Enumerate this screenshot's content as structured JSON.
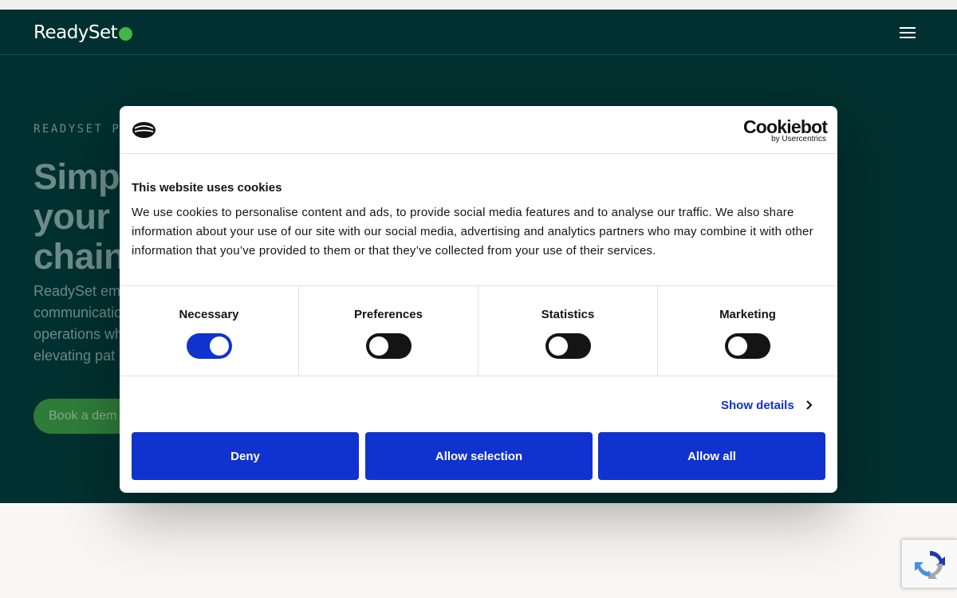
{
  "navbar": {
    "logo_text": "ReadySet",
    "brand_dot_color": "#43b549",
    "menu_icon": "hamburger-menu-icon"
  },
  "hero": {
    "eyebrow": "READYSET PL",
    "headline_lines": [
      "Simp",
      "your s",
      "chain"
    ],
    "lead_lines": [
      "ReadySet em",
      "communicatio",
      "operations wh",
      "elevating pat"
    ],
    "cta_label": "Book a dem"
  },
  "cookie_dialog": {
    "brand_name": "Cookiebot",
    "brand_sub": "by Usercentrics",
    "title": "This website uses cookies",
    "body": "We use cookies to personalise content and ads, to provide social media features and to analyse our traffic. We also share information about your use of our site with our social media, advertising and analytics partners who may combine it with other information that you’ve provided to them or that they’ve collected from your use of their services.",
    "categories": [
      {
        "label": "Necessary",
        "on": true
      },
      {
        "label": "Preferences",
        "on": false
      },
      {
        "label": "Statistics",
        "on": false
      },
      {
        "label": "Marketing",
        "on": false
      }
    ],
    "show_details": "Show details",
    "buttons": {
      "deny": "Deny",
      "allow_selection": "Allow selection",
      "allow_all": "Allow all"
    },
    "accent_color": "#1032cf"
  },
  "colors": {
    "hero_bg": "#00302f",
    "text_dark": "#141414"
  }
}
